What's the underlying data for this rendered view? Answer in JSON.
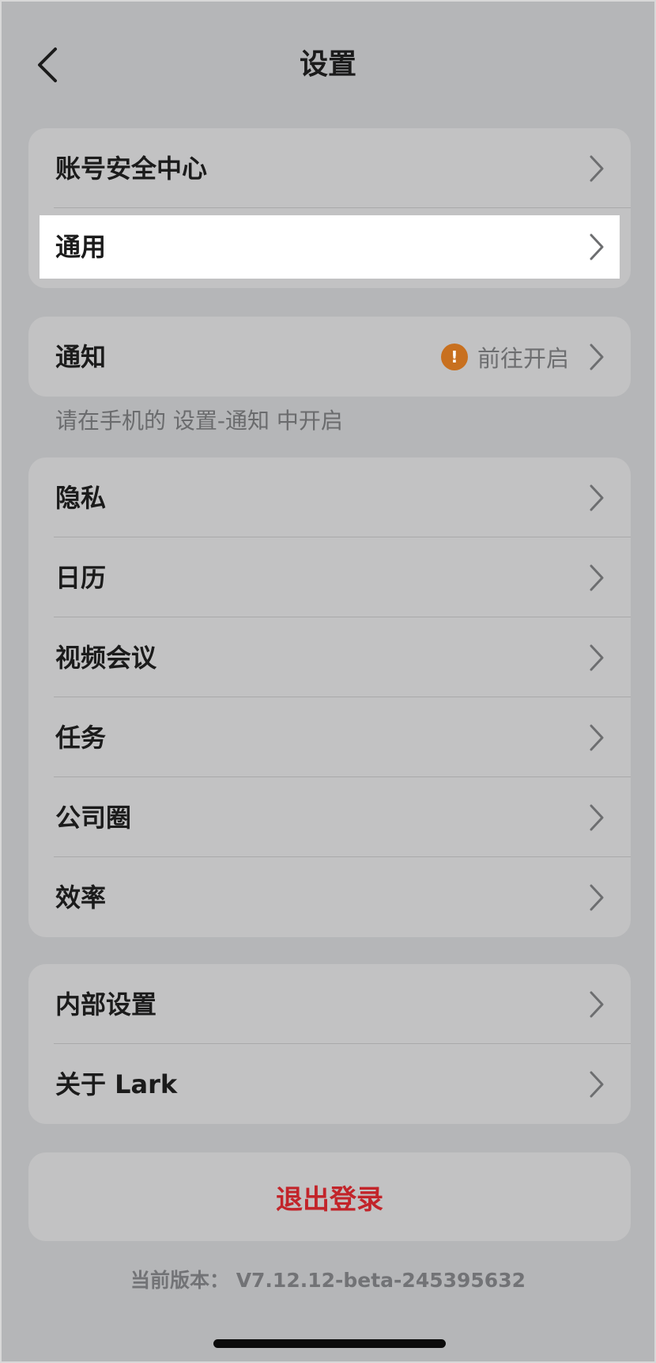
{
  "header": {
    "title": "设置"
  },
  "groups": {
    "account": {
      "items": [
        "账号安全中心",
        "通用"
      ]
    },
    "notification": {
      "label": "通知",
      "action": "前往开启",
      "warning_glyph": "!",
      "hint": "请在手机的 设置-通知 中开启"
    },
    "features": {
      "items": [
        "隐私",
        "日历",
        "视频会议",
        "任务",
        "公司圈",
        "效率"
      ]
    },
    "misc": {
      "items": [
        "内部设置",
        "关于 Lark"
      ]
    }
  },
  "logout": {
    "label": "退出登录"
  },
  "version": {
    "text": "当前版本：  V7.12.12-beta-245395632"
  },
  "colors": {
    "background": "#b5b6b8",
    "card": "#c2c2c3",
    "highlight": "#ffffff",
    "warning": "#c8701f",
    "logout_text": "#c2242a"
  }
}
